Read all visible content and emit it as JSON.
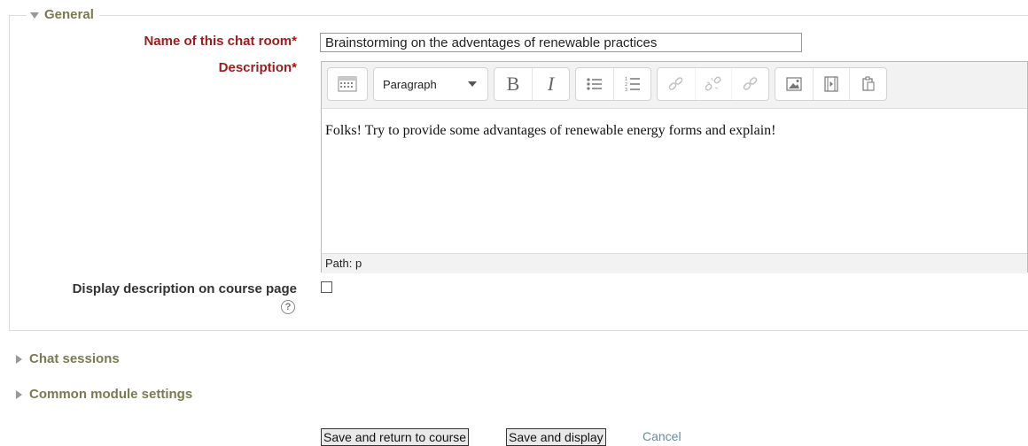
{
  "general": {
    "legend": "General",
    "name_label": "Name of this chat room",
    "required_mark": "*",
    "name_value": "Brainstorming on the adventages of renewable practices",
    "description_label": "Description",
    "display_label": "Display description on course page",
    "help_glyph": "?"
  },
  "editor": {
    "format_select": "Paragraph",
    "content": "Folks! Try to provide some advantages of renewable energy forms and explain!",
    "path": "Path: p",
    "icons": [
      "toolbar-toggle-icon",
      "bold-icon",
      "italic-icon",
      "bullet-list-icon",
      "numbered-list-icon",
      "link-icon",
      "unlink-icon",
      "anchor-icon",
      "image-icon",
      "media-icon",
      "paste-icon"
    ],
    "bold_glyph": "B",
    "italic_glyph": "I"
  },
  "sections": {
    "chat_sessions": "Chat sessions",
    "common_module": "Common module settings"
  },
  "buttons": {
    "save_return": "Save and return to course",
    "save_display": "Save and display",
    "cancel": "Cancel"
  }
}
